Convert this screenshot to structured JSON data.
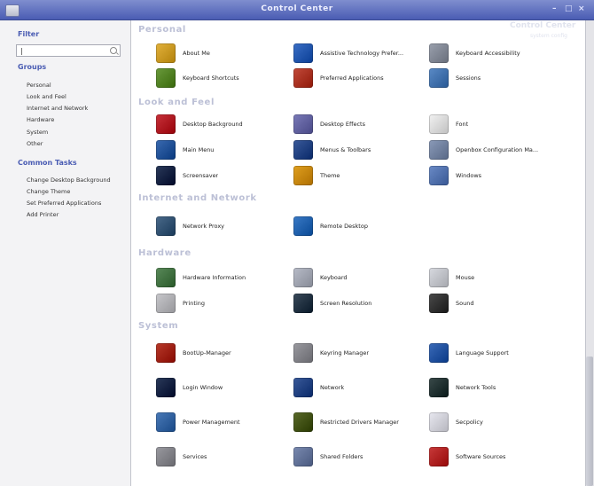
{
  "window": {
    "title": "Control Center",
    "controls": [
      "–",
      "□",
      "×"
    ],
    "ghost_title": "Control Center",
    "ghost_sub": "system config"
  },
  "sidebar": {
    "filter_label": "Filter",
    "filter_value": "|",
    "groups_label": "Groups",
    "groups": [
      "Personal",
      "Look and Feel",
      "Internet and Network",
      "Hardware",
      "System",
      "Other"
    ],
    "common_tasks_label": "Common Tasks",
    "tasks": [
      "Change Desktop Background",
      "Change Theme",
      "Set Preferred Applications",
      "Add Printer"
    ]
  },
  "categories": [
    {
      "title": "Personal",
      "items": [
        {
          "label": "About Me",
          "icon": "about-me-icon",
          "color": "#e3b23c"
        },
        {
          "label": "Assistive Technology Prefer...",
          "icon": "accessibility-icon",
          "color": "#3b6fc6"
        },
        {
          "label": "Keyboard Accessibility",
          "icon": "keyboard-accessibility-icon",
          "color": "#9aa0ad"
        },
        {
          "label": "Keyboard Shortcuts",
          "icon": "keyboard-shortcuts-icon",
          "color": "#6a9a3c"
        },
        {
          "label": "Preferred Applications",
          "icon": "preferred-applications-icon",
          "color": "#c24a3a"
        },
        {
          "label": "Sessions",
          "icon": "sessions-icon",
          "color": "#5a8ac6"
        }
      ]
    },
    {
      "title": "Look and Feel",
      "items": [
        {
          "label": "Desktop Background",
          "icon": "desktop-background-icon",
          "color": "#c8323a"
        },
        {
          "label": "Desktop Effects",
          "icon": "desktop-effects-icon",
          "color": "#7a7ab8"
        },
        {
          "label": "Font",
          "icon": "font-icon",
          "color": "#f2f2f2"
        },
        {
          "label": "Main Menu",
          "icon": "main-menu-icon",
          "color": "#3a6ab0"
        },
        {
          "label": "Menus & Toolbars",
          "icon": "menus-toolbars-icon",
          "color": "#3a5a9a"
        },
        {
          "label": "Openbox Configuration Ma...",
          "icon": "openbox-config-icon",
          "color": "#8a9ab8"
        },
        {
          "label": "Screensaver",
          "icon": "screensaver-icon",
          "color": "#2a3a5a"
        },
        {
          "label": "Theme",
          "icon": "theme-icon",
          "color": "#e0a020"
        },
        {
          "label": "Windows",
          "icon": "windows-icon",
          "color": "#6a8ac6"
        }
      ]
    },
    {
      "title": "Internet and Network",
      "items": [
        {
          "label": "Network Proxy",
          "icon": "network-proxy-icon",
          "color": "#4a6a8a"
        },
        {
          "label": "Remote Desktop",
          "icon": "remote-desktop-icon",
          "color": "#3a7ac6"
        }
      ]
    },
    {
      "title": "Hardware",
      "items": [
        {
          "label": "Hardware Information",
          "icon": "hardware-info-icon",
          "color": "#5a8a5a"
        },
        {
          "label": "Keyboard",
          "icon": "keyboard-icon",
          "color": "#b8bcc8"
        },
        {
          "label": "Mouse",
          "icon": "mouse-icon",
          "color": "#d8dae0"
        },
        {
          "label": "Printing",
          "icon": "printer-icon",
          "color": "#c8c8cc"
        },
        {
          "label": "Screen Resolution",
          "icon": "screen-resolution-icon",
          "color": "#3a4a5a"
        },
        {
          "label": "Sound",
          "icon": "sound-icon",
          "color": "#4a4a4a"
        }
      ]
    },
    {
      "title": "System",
      "items": [
        {
          "label": "BootUp-Manager",
          "icon": "bootup-manager-icon",
          "color": "#b83a2a"
        },
        {
          "label": "Keyring Manager",
          "icon": "keyring-icon",
          "color": "#9a9aa0"
        },
        {
          "label": "Language Support",
          "icon": "language-support-icon",
          "color": "#3a6ab8"
        },
        {
          "label": "Login Window",
          "icon": "login-window-icon",
          "color": "#2a3a5a"
        },
        {
          "label": "Network",
          "icon": "network-icon",
          "color": "#3a5a9a"
        },
        {
          "label": "Network Tools",
          "icon": "network-tools-icon",
          "color": "#3a4a4a"
        },
        {
          "label": "Power Management",
          "icon": "power-management-icon",
          "color": "#4a7ab8"
        },
        {
          "label": "Restricted Drivers Manager",
          "icon": "restricted-drivers-icon",
          "color": "#5a6a2a"
        },
        {
          "label": "Secpolicy",
          "icon": "secpolicy-icon",
          "color": "#e8e8f0"
        },
        {
          "label": "Services",
          "icon": "services-icon",
          "color": "#9a9aa0"
        },
        {
          "label": "Shared Folders",
          "icon": "shared-folders-icon",
          "color": "#7a8ab0"
        },
        {
          "label": "Software Sources",
          "icon": "software-sources-icon",
          "color": "#c83a3a"
        }
      ]
    }
  ],
  "colors": {
    "titlebar": "#5a6cc0",
    "accent": "#4a5cb3",
    "category": "#bcc0d6"
  }
}
